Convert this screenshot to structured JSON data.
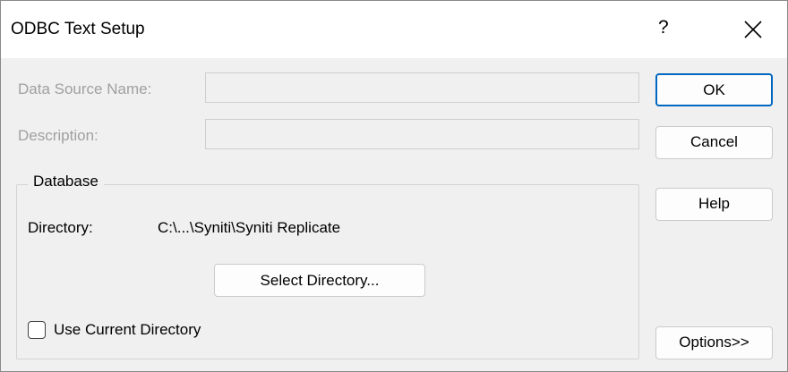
{
  "window": {
    "title": "ODBC Text Setup",
    "help_glyph": "?",
    "close_icon": "close-icon"
  },
  "form": {
    "data_source_name_label": "Data Source Name:",
    "data_source_name_value": "",
    "description_label": "Description:",
    "description_value": ""
  },
  "database": {
    "group_label": "Database",
    "directory_label": "Directory:",
    "directory_value": "C:\\...\\Syniti\\Syniti Replicate",
    "select_directory_label": "Select Directory...",
    "use_current_directory_label": "Use Current Directory",
    "use_current_directory_checked": false
  },
  "buttons": {
    "ok": "OK",
    "cancel": "Cancel",
    "help": "Help",
    "options": "Options>>"
  },
  "colors": {
    "accent": "#0067c0",
    "disabled_text": "#a0a0a0",
    "dialog_bg": "#f0f0f0"
  }
}
